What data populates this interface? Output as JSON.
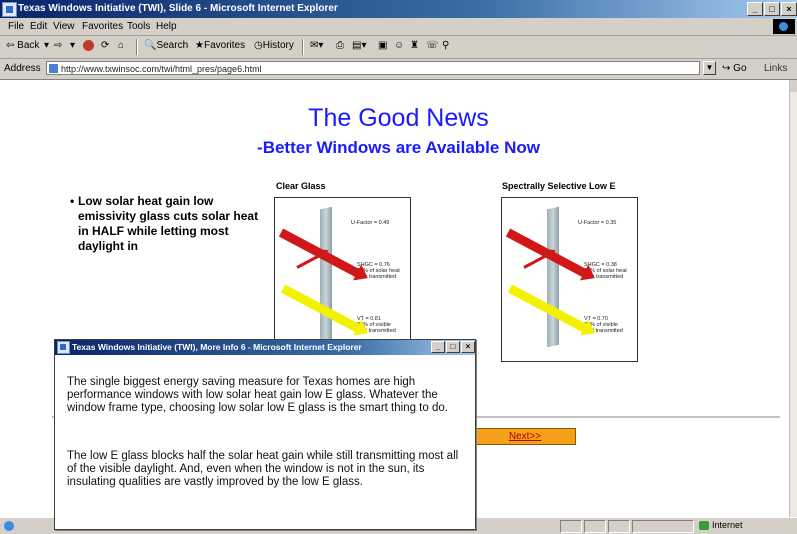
{
  "window": {
    "title": "Texas Windows Initiative (TWI), Slide 6 - Microsoft Internet Explorer",
    "controls": {
      "minimize": "_",
      "maximize": "□",
      "close": "×"
    }
  },
  "menu": {
    "items": [
      {
        "label": "File"
      },
      {
        "label": "Edit"
      },
      {
        "label": "View"
      },
      {
        "label": "Favorites"
      },
      {
        "label": "Tools"
      },
      {
        "label": "Help"
      }
    ]
  },
  "toolbar": {
    "back_label": "⇦ Back",
    "forward_label": "⇨",
    "search_label": "Search",
    "favorites_label": "Favorites",
    "history_label": "History"
  },
  "address": {
    "label": "Address",
    "value": "http://www.txwinsoc.com/twi/html_pres/page6.html",
    "go_label": "Go",
    "links_label": "Links"
  },
  "slide": {
    "title": "The Good News",
    "subtitle": "-Better Windows are Available Now",
    "bullet": "Low solar heat gain low emissivity glass cuts solar heat in HALF while letting most daylight in",
    "figures": [
      {
        "caption": "Clear Glass",
        "ufactor": "U-Factor = 0.49",
        "shgc": "SHGC = 0.76\n76% of solar heat\ngain transmitted",
        "vt": "VT = 0.81\n81% of visible\nlight transmitted"
      },
      {
        "caption": "Spectrally Selective Low E",
        "ufactor": "U-Factor = 0.35",
        "shgc": "SHGC = 0.38\n38% of solar heat\ngain transmitted",
        "vt": "VT = 0.70\n70% of visible\nlight transmitted"
      }
    ],
    "next_label": "Next>>"
  },
  "status": {
    "zone": "Internet"
  },
  "popup": {
    "title": "Texas Windows Initiative (TWI), More Info 6 - Microsoft Internet Explorer",
    "paragraph1": "The single biggest energy saving measure for Texas homes are high performance windows with low solar heat gain low E glass. Whatever the window frame type, choosing low solar low E glass is the smart thing to do.",
    "paragraph2": "The low E glass blocks half the solar heat gain while still transmitting most all of the visible daylight. And, even when the window is not in the sun, its insulating qualities are vastly improved by the low E glass."
  },
  "colors": {
    "heading": "#1a1aff",
    "title_bar": "#0a246a",
    "next_button": "#f5a01a",
    "ray_solar": "#d01818",
    "ray_visible": "#f2f200"
  }
}
